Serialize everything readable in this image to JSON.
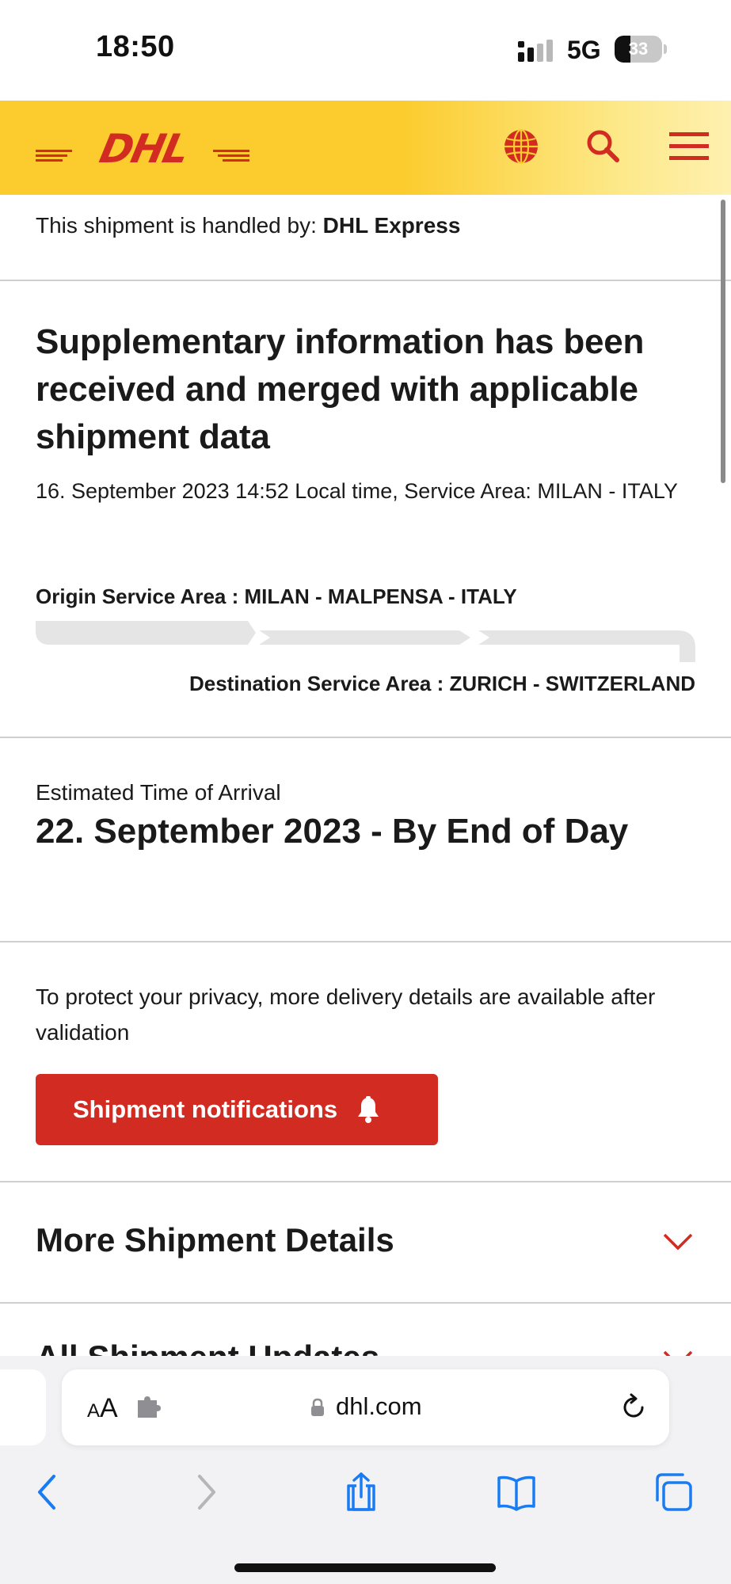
{
  "status_bar": {
    "time": "18:50",
    "network": "5G",
    "battery_percent": 33,
    "battery_label": "33"
  },
  "header": {
    "logo_text": "DHL",
    "icons": [
      "globe-icon",
      "search-icon",
      "hamburger-menu-icon"
    ]
  },
  "shipment": {
    "handled_by_label": "This shipment is handled by:",
    "handled_by_value": "DHL Express",
    "status_title": "Supplementary information has been received and merged with applicable shipment data",
    "status_meta": "16. September 2023 14:52 Local time, Service Area: MILAN - ITALY",
    "origin": "Origin Service Area : MILAN - MALPENSA - ITALY",
    "destination": "Destination Service Area : ZURICH - SWITZERLAND",
    "progress_segments": 3,
    "progress_completed": 0
  },
  "eta": {
    "label": "Estimated Time of Arrival",
    "value": "22. September 2023 - By End of Day"
  },
  "privacy": {
    "text": "To protect your privacy, more delivery details are available after validation",
    "button_label": "Shipment notifications"
  },
  "sections": {
    "more_details": "More Shipment Details",
    "all_updates": "All Shipment Updates"
  },
  "browser": {
    "text_size_label": "AA",
    "url": "dhl.com"
  },
  "colors": {
    "dhl_yellow": "#fccc2e",
    "dhl_red": "#d12b22",
    "progress_grey": "#e5e5e5"
  }
}
